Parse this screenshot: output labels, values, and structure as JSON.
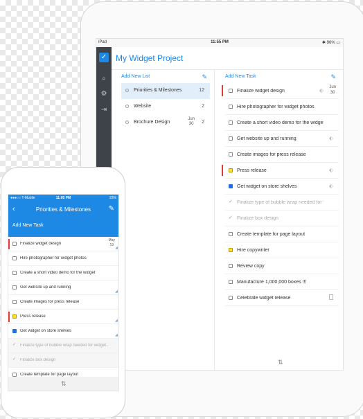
{
  "ipad": {
    "status": {
      "carrier": "iPad",
      "time": "11:55 PM",
      "battery": "96%"
    },
    "rail": {
      "icons": [
        "check-icon",
        "search-icon",
        "gear-icon",
        "share-icon"
      ]
    },
    "title": "My Widget Project",
    "lists": {
      "add_label": "Add New List",
      "items": [
        {
          "name": "Priorities & Milestones",
          "count": "12",
          "date": ""
        },
        {
          "name": "Website",
          "count": "2",
          "date": ""
        },
        {
          "name": "Brochure Design",
          "count": "2",
          "date_month": "Jun",
          "date_day": "30"
        }
      ]
    },
    "tasks": {
      "add_label": "Add New Task",
      "items": [
        {
          "name": "Finalize widget design",
          "date_month": "Jun",
          "date_day": "30"
        },
        {
          "name": "Hire photographer for widget photos"
        },
        {
          "name": "Create a short video demo for the widget"
        },
        {
          "name": "Get website up and running"
        },
        {
          "name": "Create images for press release"
        },
        {
          "name": "Press release"
        },
        {
          "name": "Get widget on store shelves"
        },
        {
          "name": "Finalize type of bubble wrap needed for widg..."
        },
        {
          "name": "Finalize box design"
        },
        {
          "name": "Create template for page layout"
        },
        {
          "name": "Hire copywriter"
        },
        {
          "name": "Review copy"
        },
        {
          "name": "Manufacture 1,000,000 boxes !!!"
        },
        {
          "name": "Celebrate widget release"
        }
      ]
    }
  },
  "iphone": {
    "status": {
      "carrier": "T-Mobile",
      "time": "11:05 PM",
      "battery": "23%"
    },
    "title": "Priorities & Milestones",
    "add_label": "Add New Task",
    "tasks": [
      {
        "name": "Finalize widget design",
        "date_month": "May",
        "date_day": "19"
      },
      {
        "name": "Hire photographer for widget photos"
      },
      {
        "name": "Create a short video demo for the widget"
      },
      {
        "name": "Get website up and running"
      },
      {
        "name": "Create images for press release"
      },
      {
        "name": "Press release"
      },
      {
        "name": "Get widget on store shelves"
      },
      {
        "name": "Finalize type of bubble wrap needed for widget..."
      },
      {
        "name": "Finalize box design"
      },
      {
        "name": "Create template for page layout"
      }
    ]
  },
  "colors": {
    "accent": "#1e88e5",
    "flag_red": "#e53935",
    "yellow": "#fde02a",
    "blue": "#1e6fe0"
  }
}
